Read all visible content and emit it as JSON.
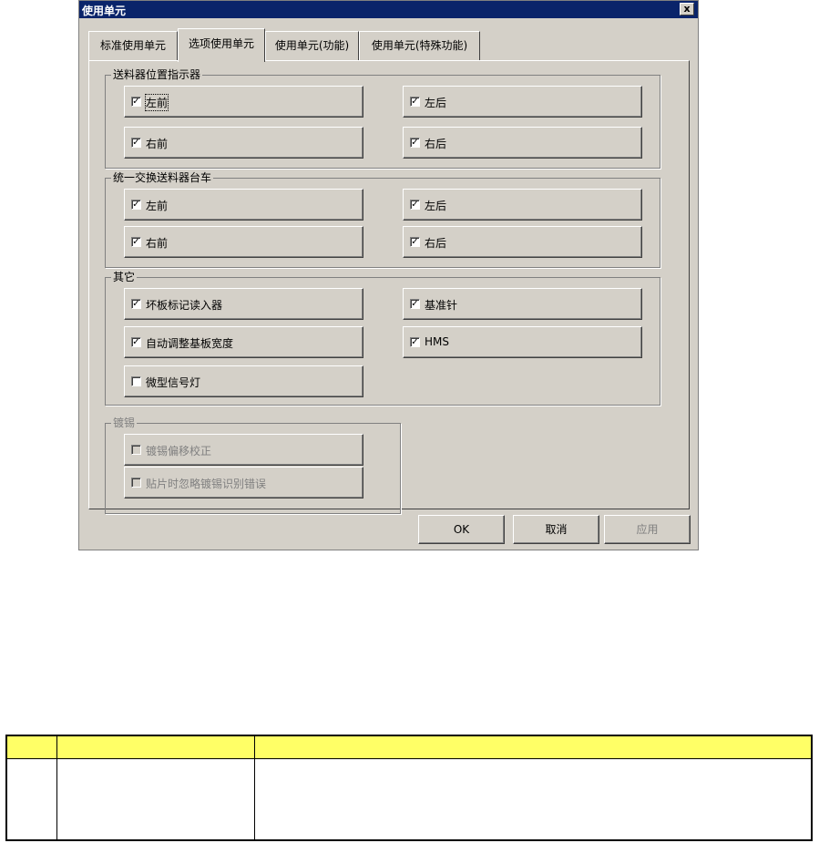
{
  "dialog": {
    "title": "使用单元",
    "close_glyph": "x",
    "tabs": [
      {
        "label": "标准使用单元"
      },
      {
        "label": "选项使用单元"
      },
      {
        "label": "使用单元(功能)"
      },
      {
        "label": "使用单元(特殊功能)"
      }
    ],
    "groups": {
      "feeder_position_indicator": {
        "label": "送料器位置指示器",
        "items": [
          {
            "label": "左前",
            "checked": true
          },
          {
            "label": "左后",
            "checked": true
          },
          {
            "label": "右前",
            "checked": true
          },
          {
            "label": "右后",
            "checked": true
          }
        ]
      },
      "bulk_exchange_cart": {
        "label": "统一交换送料器台车",
        "items": [
          {
            "label": "左前",
            "checked": true
          },
          {
            "label": "左后",
            "checked": true
          },
          {
            "label": "右前",
            "checked": true
          },
          {
            "label": "右后",
            "checked": true
          }
        ]
      },
      "other": {
        "label": "其它",
        "items": [
          {
            "label": "坏板标记读入器",
            "checked": true
          },
          {
            "label": "基准针",
            "checked": true
          },
          {
            "label": "自动调整基板宽度",
            "checked": true
          },
          {
            "label": "HMS",
            "checked": true
          },
          {
            "label": "微型信号灯",
            "checked": false
          }
        ]
      },
      "solder": {
        "label": "镀锡",
        "items": [
          {
            "label": "镀锡偏移校正",
            "checked": false
          },
          {
            "label": "贴片时忽略镀锡识别错误",
            "checked": false
          }
        ]
      }
    },
    "buttons": {
      "ok": "OK",
      "cancel": "取消",
      "apply": "应用"
    },
    "check_glyph": "✓"
  }
}
